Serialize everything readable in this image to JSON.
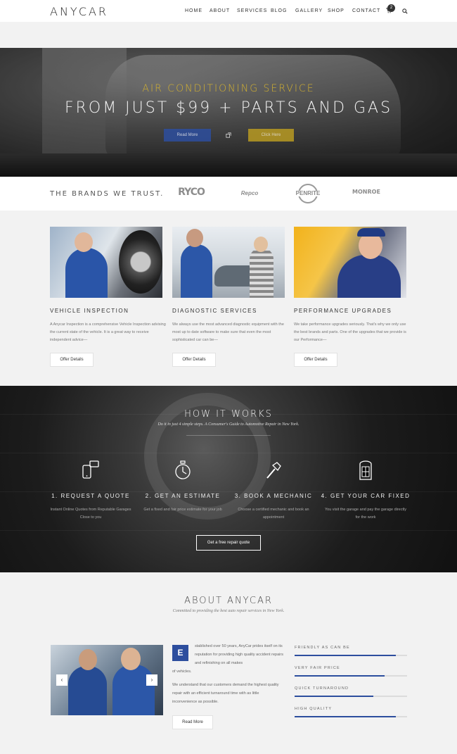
{
  "header": {
    "logo": "ANYCAR",
    "nav": [
      "HOME",
      "ABOUT",
      "SERVICES",
      "BLOG",
      "GALLERY",
      "SHOP",
      "CONTACT"
    ],
    "cart_count": "2",
    "icons": [
      "cart-icon",
      "search-icon"
    ]
  },
  "hero": {
    "subtitle": "AIR CONDITIONING SERVICE",
    "title": "FROM JUST $99 + PARTS AND GAS",
    "read_more": "Read More",
    "click_here": "Click Here"
  },
  "brands": {
    "title": "THE BRANDS WE TRUST.",
    "items": [
      "RYCO",
      "Repco",
      "PENRITE",
      "MONROE"
    ]
  },
  "services": [
    {
      "title": "VEHICLE INSPECTION",
      "text": "A Anycar Inspection is a comprehensive Vehicle Inspection advising the current state of the vehicle. It is a great way to receive independent advice—",
      "button": "Offer Details"
    },
    {
      "title": "DIAGNOSTIC SERVICES",
      "text": "We always use the most advanced diagnostic equipment with the most up to date software to make sure that even the most sophisticated car can be—",
      "button": "Offer Details"
    },
    {
      "title": "PERFORMANCE UPGRADES",
      "text": "We take performance upgrades seriously. That's why we only use the best brands and parts. One of the upgrades that we provide is our Performance—",
      "button": "Offer Details"
    }
  ],
  "how": {
    "title": "HOW IT WORKS",
    "subtitle": "Do it in just 4 simple steps. A Consumer's Guide to Automotive Repair in New York.",
    "steps": [
      {
        "icon": "phone-chat-icon",
        "title": "1. REQUEST A QUOTE",
        "text": "Instant Online Quotes from Reputable Garages Close to you"
      },
      {
        "icon": "stopwatch-icon",
        "title": "2. GET AN ESTIMATE",
        "text": "Get a fixed and fair price estimate for your job"
      },
      {
        "icon": "hammer-icon",
        "title": "3. BOOK A MECHANIC",
        "text": "Choose a certified mechanic and book an appointment"
      },
      {
        "icon": "phone-booth-icon",
        "title": "4. GET YOUR CAR FIXED",
        "text": "You visit the garage and pay the garage directly for the work"
      }
    ],
    "button": "Get a free repair quote"
  },
  "about": {
    "title": "ABOUT ANYCAR",
    "subtitle": "Committed to providing the best auto repair services in New York.",
    "dropcap": "E",
    "p1": "stablished over 50 years, AnyCar prides itself on its reputation for providing high quality accident repairs and refinishing on all makes",
    "p1_end": "of vehicles.",
    "p2": "We understand that our customers demand the highest quality repair with an efficient turnaround time with as little inconvenience as possible.",
    "button": "Read More",
    "arrow_prev": "‹",
    "arrow_next": "›",
    "skills": [
      {
        "label": "FRIENDLY AS CAN BE",
        "level": 0.9
      },
      {
        "label": "VERY FAIR PRICE",
        "level": 0.8
      },
      {
        "label": "QUICK TURNAROUND",
        "level": 0.7
      },
      {
        "label": "HIGH QUALITY",
        "level": 0.9
      }
    ]
  },
  "colors": {
    "accent_blue": "#2d4e9e",
    "accent_gold": "#d4b230"
  }
}
